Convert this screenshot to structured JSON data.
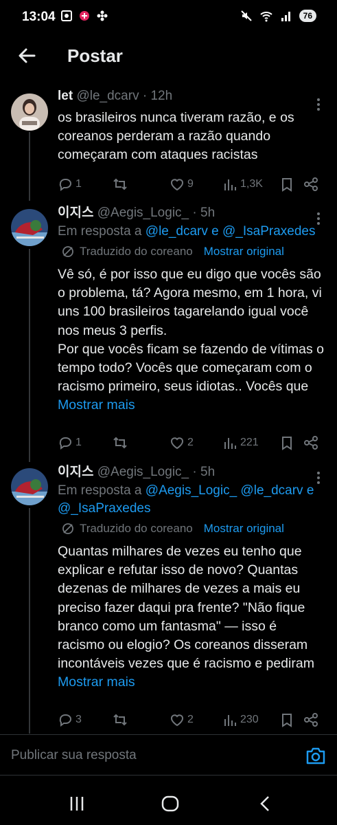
{
  "status": {
    "time": "13:04",
    "battery": "76"
  },
  "header": {
    "title": "Postar"
  },
  "posts": [
    {
      "author": "let",
      "handle": "@le_dcarv",
      "time": "12h",
      "reply_prefix": "",
      "text": "os brasileiros nunca tiveram razão, e os coreanos perderam a razão quando começaram com ataques racistas",
      "replies": "1",
      "reposts": "",
      "likes": "9",
      "views": "1,3K"
    },
    {
      "author": "이지스",
      "handle": "@Aegis_Logic_",
      "time": "5h",
      "reply_prefix": "Em resposta a",
      "reply_mentions": "@le_dcarv e @_IsaPraxedes",
      "translated_label": "Traduzido do coreano",
      "show_original": "Mostrar original",
      "text": "Vê só, é por isso que eu digo que vocês são o problema, tá? Agora mesmo, em 1 hora, vi uns 100 brasileiros tagarelando igual você nos meus 3 perfis.\nPor que vocês ficam se fazendo de vítimas o tempo todo? Vocês que começaram com o racismo primeiro, seus idiotas.. Vocês que",
      "show_more": "Mostrar mais",
      "replies": "1",
      "likes": "2",
      "views": "221"
    },
    {
      "author": "이지스",
      "handle": "@Aegis_Logic_",
      "time": "5h",
      "reply_prefix": "Em resposta a",
      "reply_mentions": "@Aegis_Logic_ @le_dcarv e @_IsaPraxedes",
      "translated_label": "Traduzido do coreano",
      "show_original": "Mostrar original",
      "text": "Quantas milhares de vezes eu tenho que explicar e refutar isso de novo? Quantas dezenas de milhares de vezes a mais eu preciso fazer daqui pra frente? \"Não fique branco como um fantasma\" — isso é racismo ou elogio? Os coreanos disseram incontáveis vezes que é racismo e pediram",
      "show_more": "Mostrar mais",
      "replies": "3",
      "likes": "2",
      "views": "230"
    }
  ],
  "reply_bar": {
    "placeholder": "Publicar sua resposta"
  },
  "icons": {
    "back": "arrow-left-icon",
    "more": "more-vertical-icon",
    "reply": "reply-icon",
    "repost": "repost-icon",
    "like": "heart-icon",
    "views": "views-icon",
    "bookmark": "bookmark-icon",
    "share": "share-icon",
    "camera": "camera-icon"
  },
  "colors": {
    "background": "#000000",
    "text": "#e7e9ea",
    "muted": "#71767b",
    "link": "#1d9bf0"
  }
}
